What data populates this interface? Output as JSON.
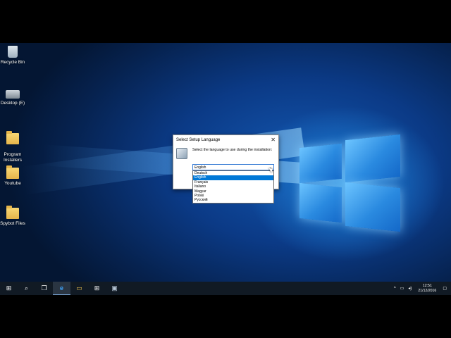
{
  "desktop": {
    "icons": [
      {
        "label": "Recycle Bin",
        "icon": "recycle-bin-icon"
      },
      {
        "label": "Desktop (E)",
        "icon": "drive-icon"
      },
      {
        "label": "Program\nInstallers",
        "icon": "folder-icon"
      },
      {
        "label": "Youtube",
        "icon": "folder-icon"
      },
      {
        "label": "Spybot Files",
        "icon": "folder-icon"
      }
    ]
  },
  "dialog": {
    "title": "Select Setup Language",
    "close_glyph": "✕",
    "prompt": "Select the language to use during the installation:",
    "selected_language": "English",
    "options": [
      "Deutsch",
      "English",
      "Français",
      "Italiano",
      "Magyar",
      "Polski",
      "Русский"
    ],
    "highlighted_index": 1
  },
  "taskbar": {
    "start_glyph": "⊞",
    "search_glyph": "⌕",
    "taskview_glyph": "❐",
    "edge_glyph": "e",
    "explorer_glyph": "▭",
    "store_glyph": "⊞",
    "setup_glyph": "▣",
    "tray_chevron": "^",
    "clock_time": "12:51",
    "clock_date": "21/12/2016"
  },
  "colors": {
    "accent": "#0078d7",
    "taskbar": "#111a24"
  }
}
